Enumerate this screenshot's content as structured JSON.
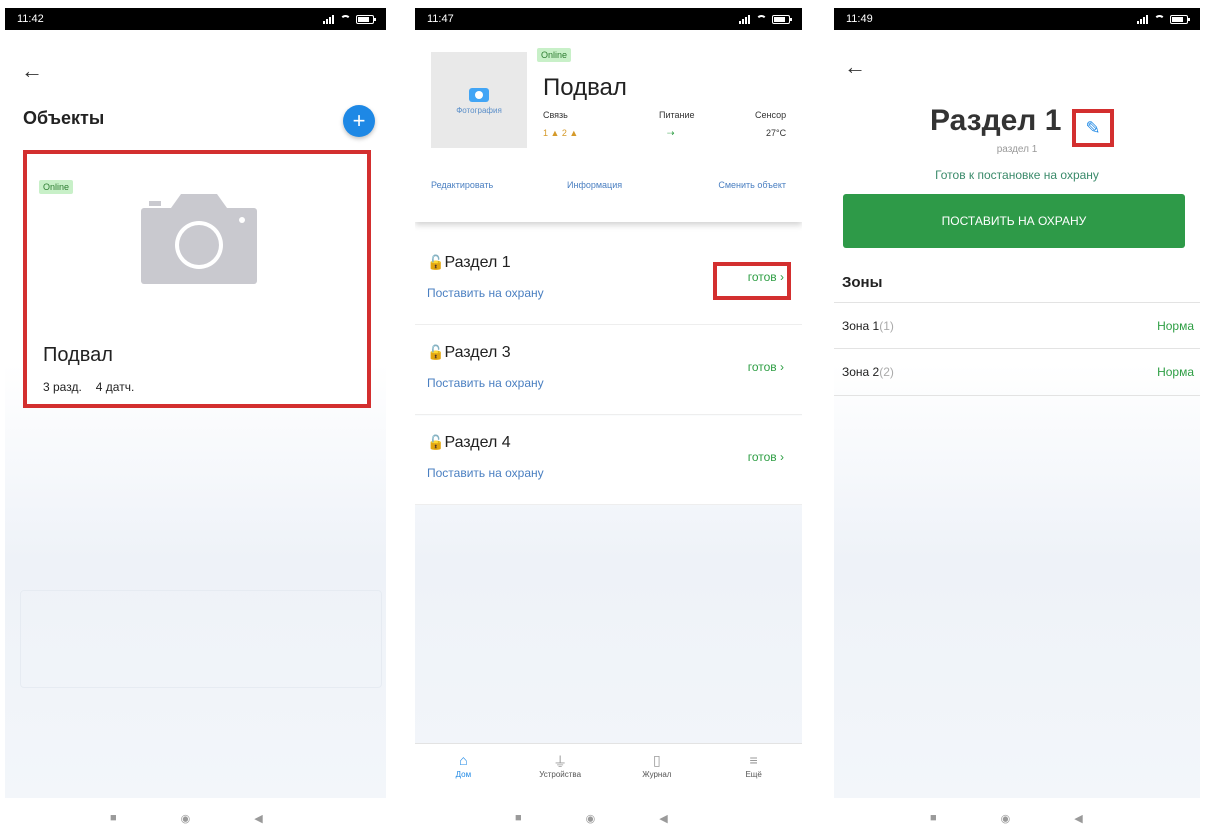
{
  "panel1": {
    "time": "11:42",
    "title": "Объекты",
    "add_label": "+",
    "card": {
      "status": "Online",
      "name": "Подвал",
      "sections": "3 разд.",
      "sensors": "4 датч."
    }
  },
  "panel2": {
    "time": "11:47",
    "object": {
      "status": "Online",
      "photo_label": "Фотография",
      "name": "Подвал",
      "link_label": "Связь",
      "link_value": "1 ▲ 2 ▲",
      "power_label": "Питание",
      "power_value": "⇢",
      "sensor_label": "Сенсор",
      "sensor_value": "27°C",
      "actions": [
        "Редактировать",
        "Информация",
        "Сменить объект"
      ]
    },
    "sections": [
      {
        "name": "Раздел 1",
        "action": "Поставить на охрану",
        "state": "готов"
      },
      {
        "name": "Раздел 3",
        "action": "Поставить на охрану",
        "state": "готов"
      },
      {
        "name": "Раздел 4",
        "action": "Поставить на охрану",
        "state": "готов"
      }
    ],
    "nav": [
      {
        "label": "Дом",
        "icon": "home-icon"
      },
      {
        "label": "Устройства",
        "icon": "plug-icon"
      },
      {
        "label": "Журнал",
        "icon": "document-icon"
      },
      {
        "label": "Ещё",
        "icon": "menu-icon"
      }
    ]
  },
  "panel3": {
    "time": "11:49",
    "title": "Раздел 1",
    "subtitle": "раздел 1",
    "status": "Готов к постановке на охрану",
    "arm_button": "ПОСТАВИТЬ НА ОХРАНУ",
    "zones_title": "Зоны",
    "zones": [
      {
        "name": "Зона 1",
        "num": "(1)",
        "state": "Норма"
      },
      {
        "name": "Зона 2",
        "num": "(2)",
        "state": "Норма"
      }
    ]
  },
  "colors": {
    "accent": "#1e88e5",
    "green": "#2e9a48",
    "highlight": "#d32f2f"
  }
}
